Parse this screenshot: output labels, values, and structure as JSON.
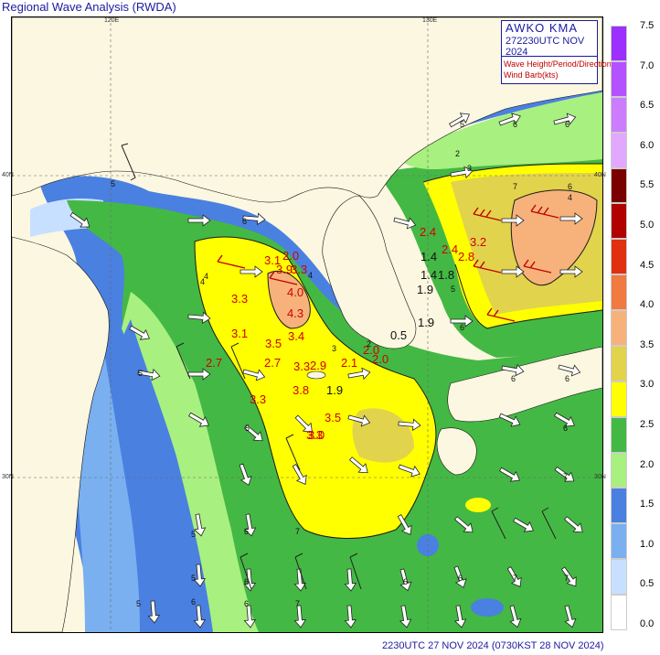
{
  "title": "Regional Wave Analysis (RWDA)",
  "footer": "2230UTC 27 NOV 2024 (0730KST 28 NOV 2024)",
  "infobox": {
    "agency": "AWKO  KMA",
    "time": "272230UTC NOV 2024",
    "line1": "Wave Height/Period/Direction",
    "line2": "Wind Barb(kts)"
  },
  "grid": {
    "lon_120": "120E",
    "lon_130": "130E",
    "lat_40_left": "40N",
    "lat_40_right": "40N",
    "lat_30_left": "30N",
    "lat_30_right": "30N"
  },
  "legend": {
    "labels": [
      "7.5",
      "7.0",
      "6.5",
      "6.0",
      "5.5",
      "5.0",
      "4.5",
      "4.0",
      "3.5",
      "3.0",
      "2.5",
      "2.0",
      "1.5",
      "1.0",
      "0.5",
      "0.0"
    ],
    "colors": [
      "#9b30ff",
      "#b452ff",
      "#cc7cff",
      "#e2a8ff",
      "#7a0000",
      "#b00000",
      "#e03010",
      "#f07a40",
      "#f6b27a",
      "#e2d34c",
      "#ffff00",
      "#44b844",
      "#a8f080",
      "#4a80e0",
      "#7ab0f0",
      "#c8e0ff",
      "#ffffff"
    ]
  },
  "wave_heights_red": [
    "2.0",
    "3.1",
    "3.3",
    "3.9",
    "3.3",
    "4.0",
    "3.1",
    "4.3",
    "3.5",
    "3.4",
    "2.7",
    "2.7",
    "3.3",
    "3.3",
    "2.9",
    "2.1",
    "2.0",
    "2.0",
    "3.8",
    "3.3",
    "3.5",
    "3.0",
    "2.4",
    "2.4",
    "3.2",
    "2.8"
  ],
  "wave_heights_black": [
    "1.4",
    "1.4",
    "1.8",
    "1.9",
    "1.9",
    "1.9",
    "0.5"
  ],
  "contour_labels": [
    "4",
    "5",
    "4",
    "6",
    "2",
    "3",
    "5",
    "6"
  ],
  "period_labels": [
    "5",
    "6",
    "7",
    "6",
    "5",
    "4",
    "4",
    "3",
    "2",
    "6",
    "5",
    "6",
    "6",
    "5",
    "6",
    "7",
    "6",
    "7",
    "5",
    "6",
    "6",
    "6",
    "7",
    "6",
    "7",
    "7",
    "5",
    "6"
  ]
}
